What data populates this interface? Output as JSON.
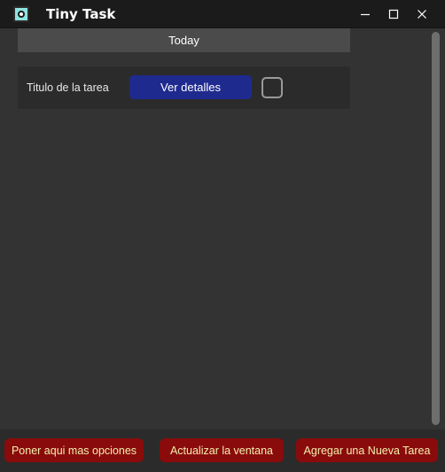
{
  "window": {
    "title": "Tiny Task",
    "icon": "app-icon",
    "controls": [
      "minimize-icon",
      "maximize-icon",
      "close-icon"
    ]
  },
  "day_header": {
    "label": "Today"
  },
  "tasks": [
    {
      "title": "Titulo de la tarea",
      "details_label": "Ver detalles",
      "completed": false
    }
  ],
  "footer": {
    "more_options_label": "Poner aqui mas opciones",
    "refresh_label": "Actualizar la ventana",
    "add_task_label": "Agregar una Nueva Tarea"
  },
  "colors": {
    "background": "#333333",
    "titlebar": "#1b1b1b",
    "details_button": "#1f2a8f",
    "action_button": "#8a0b0b",
    "action_button_text": "#f2f0b0"
  }
}
